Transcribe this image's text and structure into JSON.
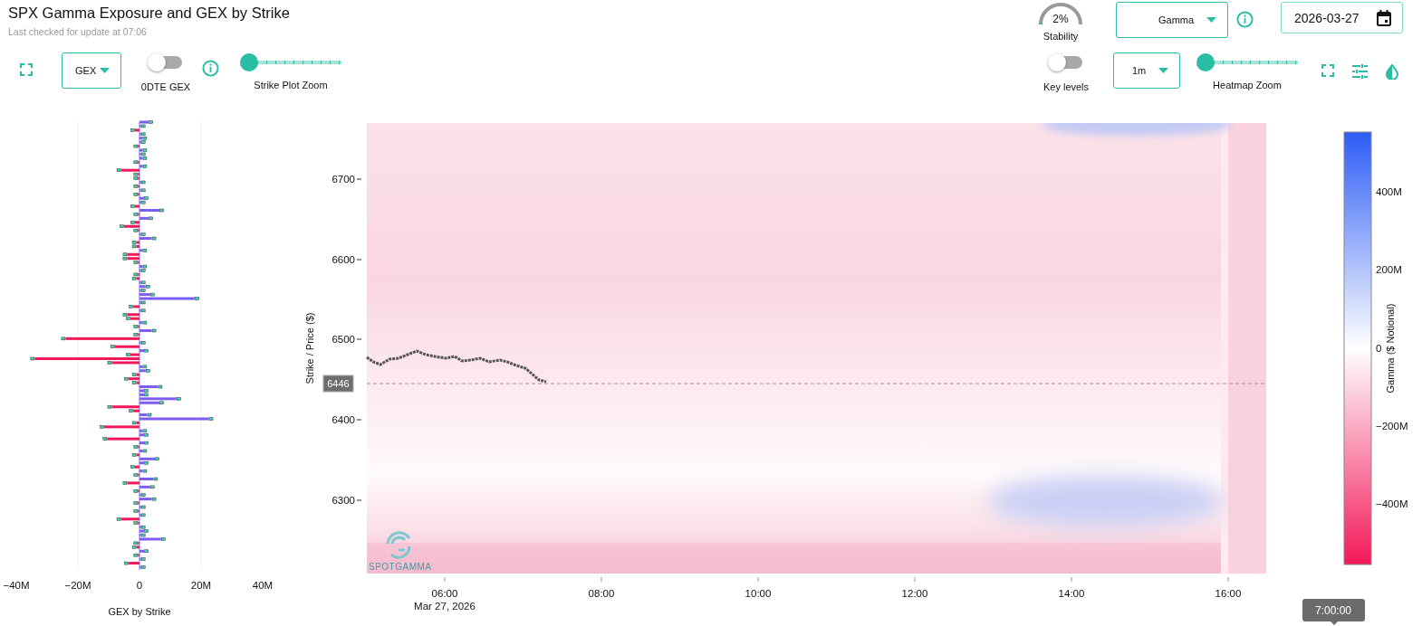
{
  "title": "SPX Gamma Exposure and GEX by Strike",
  "subtitle": "Last checked for update at 07:06",
  "left_controls": {
    "metric_select": {
      "value": "GEX"
    },
    "toggle": {
      "label": "0DTE GEX",
      "on": false
    },
    "slider": {
      "label": "Strike Plot Zoom",
      "level": 0
    }
  },
  "stability": {
    "reading": "2%",
    "label": "Stability"
  },
  "greek_select": {
    "value": "Gamma"
  },
  "date_field": {
    "value": "2026-03-27"
  },
  "right_controls": {
    "toggle": {
      "label": "Key levels",
      "on": false
    },
    "interval_select": {
      "value": "1m"
    },
    "slider": {
      "label": "Heatmap Zoom",
      "level": 0
    }
  },
  "strike_chart": {
    "chart_data": {
      "type": "bar",
      "orientation": "horizontal",
      "stacked": true,
      "xlabel": "GEX by Strike",
      "xlim": [
        -40,
        40
      ],
      "xticks": [
        {
          "value": -40,
          "label": "−40M"
        },
        {
          "value": -20,
          "label": "−20M"
        },
        {
          "value": 0,
          "label": "0"
        },
        {
          "value": 20,
          "label": "20M"
        },
        {
          "value": 40,
          "label": "40M"
        }
      ],
      "series": [
        {
          "color": "#7c5cf2",
          "values": [
            3,
            0.5,
            null,
            0.5,
            1,
            0.5,
            null,
            1,
            0.5,
            1,
            null,
            1,
            null,
            null,
            null,
            0.5,
            null,
            0.5,
            null,
            1.5,
            0.5,
            null,
            6.5,
            null,
            3,
            null,
            null,
            null,
            0.5,
            4,
            null,
            null,
            1,
            null,
            null,
            null,
            1,
            0.5,
            null,
            null,
            0.5,
            2,
            0.5,
            3.5,
            18,
            0.5,
            null,
            0.5,
            null,
            null,
            1,
            null,
            4,
            null,
            null,
            0.5,
            null,
            1.5,
            null,
            null,
            null,
            1,
            2,
            null,
            null,
            null,
            6,
            1.5,
            1.5,
            12,
            6.5,
            null,
            null,
            2.5,
            22.5,
            null,
            null,
            1,
            1.5,
            null,
            1.5,
            null,
            1,
            null,
            5,
            1.5,
            null,
            1,
            null,
            4.5,
            null,
            3.5,
            null,
            0.5,
            4,
            null,
            0.5,
            null,
            0.5,
            null,
            null,
            0.5,
            1.5,
            0.5,
            7,
            null,
            null,
            1.5,
            null,
            0.5,
            null,
            0.5
          ]
        },
        {
          "color": "#f2185a",
          "values": [
            null,
            null,
            -1.5,
            null,
            null,
            null,
            -0.5,
            null,
            null,
            null,
            -0.5,
            null,
            -6,
            -0.5,
            -0.5,
            null,
            -0.5,
            null,
            -0.5,
            null,
            null,
            -1.5,
            null,
            -0.5,
            null,
            -1.5,
            -5,
            -0.5,
            null,
            null,
            -1,
            -1,
            null,
            -4,
            -4,
            -0.5,
            null,
            null,
            -0.5,
            -1,
            null,
            null,
            null,
            null,
            null,
            null,
            -2,
            null,
            -4,
            -3,
            null,
            -0.5,
            null,
            -0.5,
            -24,
            null,
            -8,
            null,
            -3,
            -34,
            -9,
            null,
            null,
            -1,
            -3.5,
            -1,
            null,
            null,
            null,
            null,
            null,
            -9,
            -2,
            null,
            null,
            -1,
            -11.5,
            null,
            null,
            -10.5,
            null,
            -0.5,
            null,
            -1,
            null,
            null,
            -1.5,
            null,
            -0.5,
            null,
            -4,
            null,
            -0.5,
            null,
            null,
            -0.5,
            null,
            -0.5,
            null,
            -6,
            -0.5,
            null,
            null,
            null,
            null,
            -0.5,
            -1,
            null,
            -0.5,
            null,
            -3.5,
            null
          ]
        }
      ]
    }
  },
  "heatmap": {
    "ylabel": "Strike / Price ($)",
    "yticks": [
      "6700",
      "6600",
      "6500",
      "6400",
      "6300"
    ],
    "xticks": [
      {
        "label": "06:00",
        "sublabel": "Mar 27, 2026"
      },
      {
        "label": "08:00"
      },
      {
        "label": "10:00"
      },
      {
        "label": "12:00"
      },
      {
        "label": "14:00"
      },
      {
        "label": "16:00"
      }
    ],
    "price_label": "6446",
    "logo": "SPOTGAMMA"
  },
  "colorbar": {
    "label": "Gamma ($ Notional)",
    "ticks": [
      "400M",
      "200M",
      "0",
      "−200M",
      "−400M"
    ]
  },
  "time_tooltip": "7:00:00"
}
